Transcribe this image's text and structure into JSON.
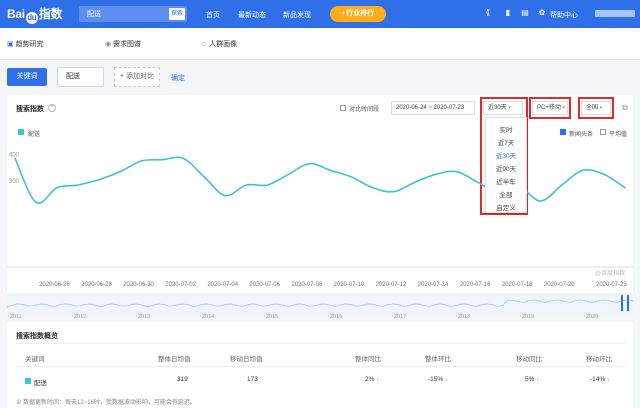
{
  "header": {
    "logo_text_1": "Bai",
    "logo_paw": "du",
    "logo_text_2": "指数",
    "search_value": "配送",
    "search_btn": "探索",
    "nav": [
      "首页",
      "最新动态",
      "新品发现"
    ],
    "rank_btn": "◐行业排行",
    "help": "帮助中心"
  },
  "subnav": {
    "trend": "趋势研究",
    "demand": "需求图谱",
    "crowd": "人群画像"
  },
  "keyword_bar": {
    "button": "关键词",
    "keyword": "配送",
    "add_compare": "+ 添加对比",
    "confirm": "确定"
  },
  "index_panel": {
    "title": "搜索指数",
    "compare_period": "对比时间段",
    "date_range": "2020-06-24 ~ 2020-07-23",
    "period_select": "近30天",
    "device_select": "PC+移动",
    "region_select": "全国",
    "legend": "配送",
    "news_head": "新闻头条",
    "average": "平均值",
    "watermark": "@百度指数",
    "period_options": [
      "实时",
      "近7天",
      "近30天",
      "近90天",
      "近半年",
      "全部",
      "自定义"
    ],
    "selected_period": "近30天",
    "timeline_years": [
      "2011",
      "2012",
      "2013",
      "2014",
      "2015",
      "2016",
      "2017",
      "2018",
      "2019",
      "2020"
    ]
  },
  "chart_data": {
    "type": "line",
    "title": "",
    "xlabel": "",
    "ylabel": "",
    "x": [
      "2020-06-24",
      "2020-06-25",
      "2020-06-26",
      "2020-06-27",
      "2020-06-28",
      "2020-06-29",
      "2020-06-30",
      "2020-07-01",
      "2020-07-02",
      "2020-07-03",
      "2020-07-04",
      "2020-07-05",
      "2020-07-06",
      "2020-07-07",
      "2020-07-08",
      "2020-07-09",
      "2020-07-10",
      "2020-07-11",
      "2020-07-12",
      "2020-07-13",
      "2020-07-14",
      "2020-07-15",
      "2020-07-16",
      "2020-07-17",
      "2020-07-18",
      "2020-07-19",
      "2020-07-20",
      "2020-07-21",
      "2020-07-22",
      "2020-07-23"
    ],
    "x_tick_labels": [
      "2020-06-26",
      "2020-06-28",
      "2020-06-30",
      "2020-07-02",
      "2020-07-04",
      "2020-07-06",
      "2020-07-08",
      "2020-07-10",
      "2020-07-12",
      "2020-07-14",
      "2020-07-16",
      "2020-07-18",
      "2020-07-20",
      "2020-07-23"
    ],
    "series": [
      {
        "name": "配送",
        "color": "#3ec0e0",
        "values": [
          400,
          235,
          290,
          300,
          320,
          350,
          390,
          395,
          400,
          330,
          260,
          300,
          300,
          340,
          380,
          355,
          330,
          290,
          275,
          310,
          340,
          350,
          310,
          270,
          290,
          240,
          300,
          355,
          340,
          290
        ]
      }
    ],
    "y_tick_labels": [
      "400",
      "300"
    ],
    "ylim": [
      0,
      450
    ],
    "grid": false
  },
  "summary": {
    "title": "搜索指数概览",
    "headers": [
      "关键词",
      "整体日均值",
      "移动日均值",
      "整体同比",
      "整体环比",
      "移动同比",
      "移动环比"
    ],
    "row": {
      "keyword": "配送",
      "overall_avg": "319",
      "mobile_avg": "173",
      "overall_yoy": "2%",
      "overall_mom": "-15%",
      "mobile_yoy": "5%",
      "mobile_mom": "-14%"
    },
    "footnote": "① 数据更新时间：每天12~16时，受数据波动影响，可能会有延迟。"
  },
  "colors": {
    "brand": "#2f6fe8",
    "line": "#3ec0e0",
    "highlight": "#e02a2a"
  }
}
